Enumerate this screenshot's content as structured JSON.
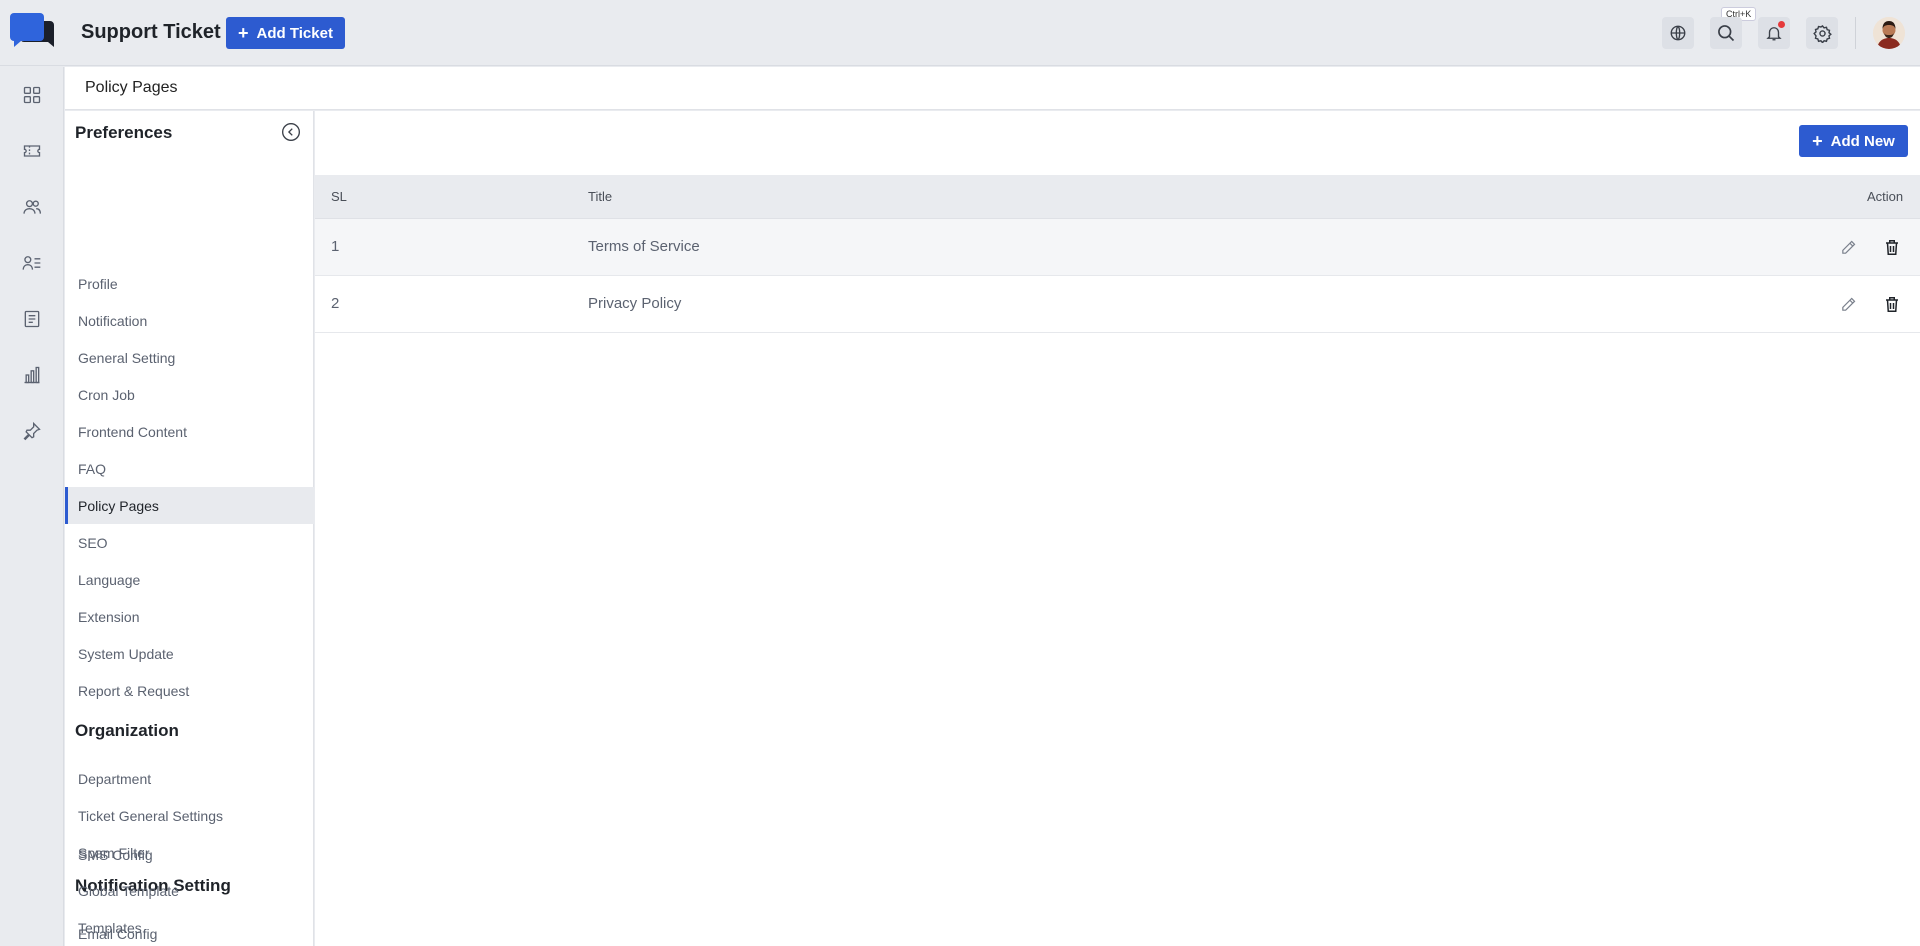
{
  "header": {
    "app_title": "Support Ticket",
    "add_ticket_label": "Add Ticket",
    "search_shortcut": "Ctrl+K"
  },
  "breadcrumb": {
    "title": "Policy Pages"
  },
  "sidemenu": {
    "sections": [
      {
        "title": "Preferences",
        "items": [
          "Profile",
          "Notification",
          "General Setting",
          "Cron Job",
          "Frontend Content",
          "FAQ",
          "Policy Pages",
          "SEO",
          "Language",
          "Extension",
          "System Update",
          "Report & Request"
        ]
      },
      {
        "title": "Organization",
        "items": [
          "Department",
          "Ticket General Settings",
          "Spam Filter"
        ]
      },
      {
        "title": "Notification Setting",
        "items": [
          "Email Config",
          "SMS Config",
          "Global Template",
          "Templates"
        ]
      }
    ],
    "active_item": "Policy Pages"
  },
  "table": {
    "add_new_label": "Add New",
    "columns": [
      "SL",
      "Title",
      "Action"
    ],
    "rows": [
      {
        "sl": "1",
        "title": "Terms of Service"
      },
      {
        "sl": "2",
        "title": "Privacy Policy"
      }
    ]
  },
  "icons": {
    "rail": [
      "dashboard-icon",
      "ticket-icon",
      "users-icon",
      "user-list-icon",
      "article-icon",
      "chart-icon",
      "pin-icon"
    ],
    "topbar": [
      "globe-icon",
      "search-icon",
      "bell-icon",
      "gear-icon"
    ]
  },
  "colors": {
    "accent": "#2d5bd0",
    "notification_dot": "#e5393b"
  }
}
